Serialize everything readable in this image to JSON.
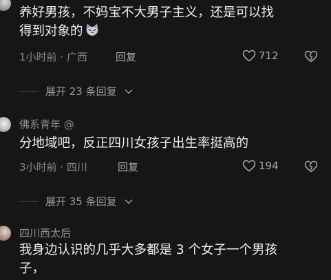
{
  "comments": [
    {
      "text_lines": [
        "养好男孩，不妈宝不大男子主义，还是可以找",
        "得到对象的"
      ],
      "emoji": "cat-emoji",
      "time_location": "1小时前 · 广西",
      "reply_label": "回复",
      "likes": "712",
      "expand_label": "展开 23 条回复"
    },
    {
      "username": "佛系青年 @",
      "text_lines": [
        "分地域吧，反正四川女孩子出生率挺高的"
      ],
      "time_location": "3小时前 · 四川",
      "reply_label": "回复",
      "likes": "194",
      "expand_label": "展开 35 条回复"
    },
    {
      "username": "四川西太后",
      "text_lines": [
        "我身边认识的几乎大多都是 3 个女子一个男孩",
        "子，"
      ]
    }
  ],
  "icons": {
    "like": "heart-outline-icon",
    "dislike": "broken-heart-icon",
    "expand": "chevron-down-icon"
  },
  "colors": {
    "background": "#161616",
    "text": "#efefef",
    "muted": "#8a8a8a"
  }
}
